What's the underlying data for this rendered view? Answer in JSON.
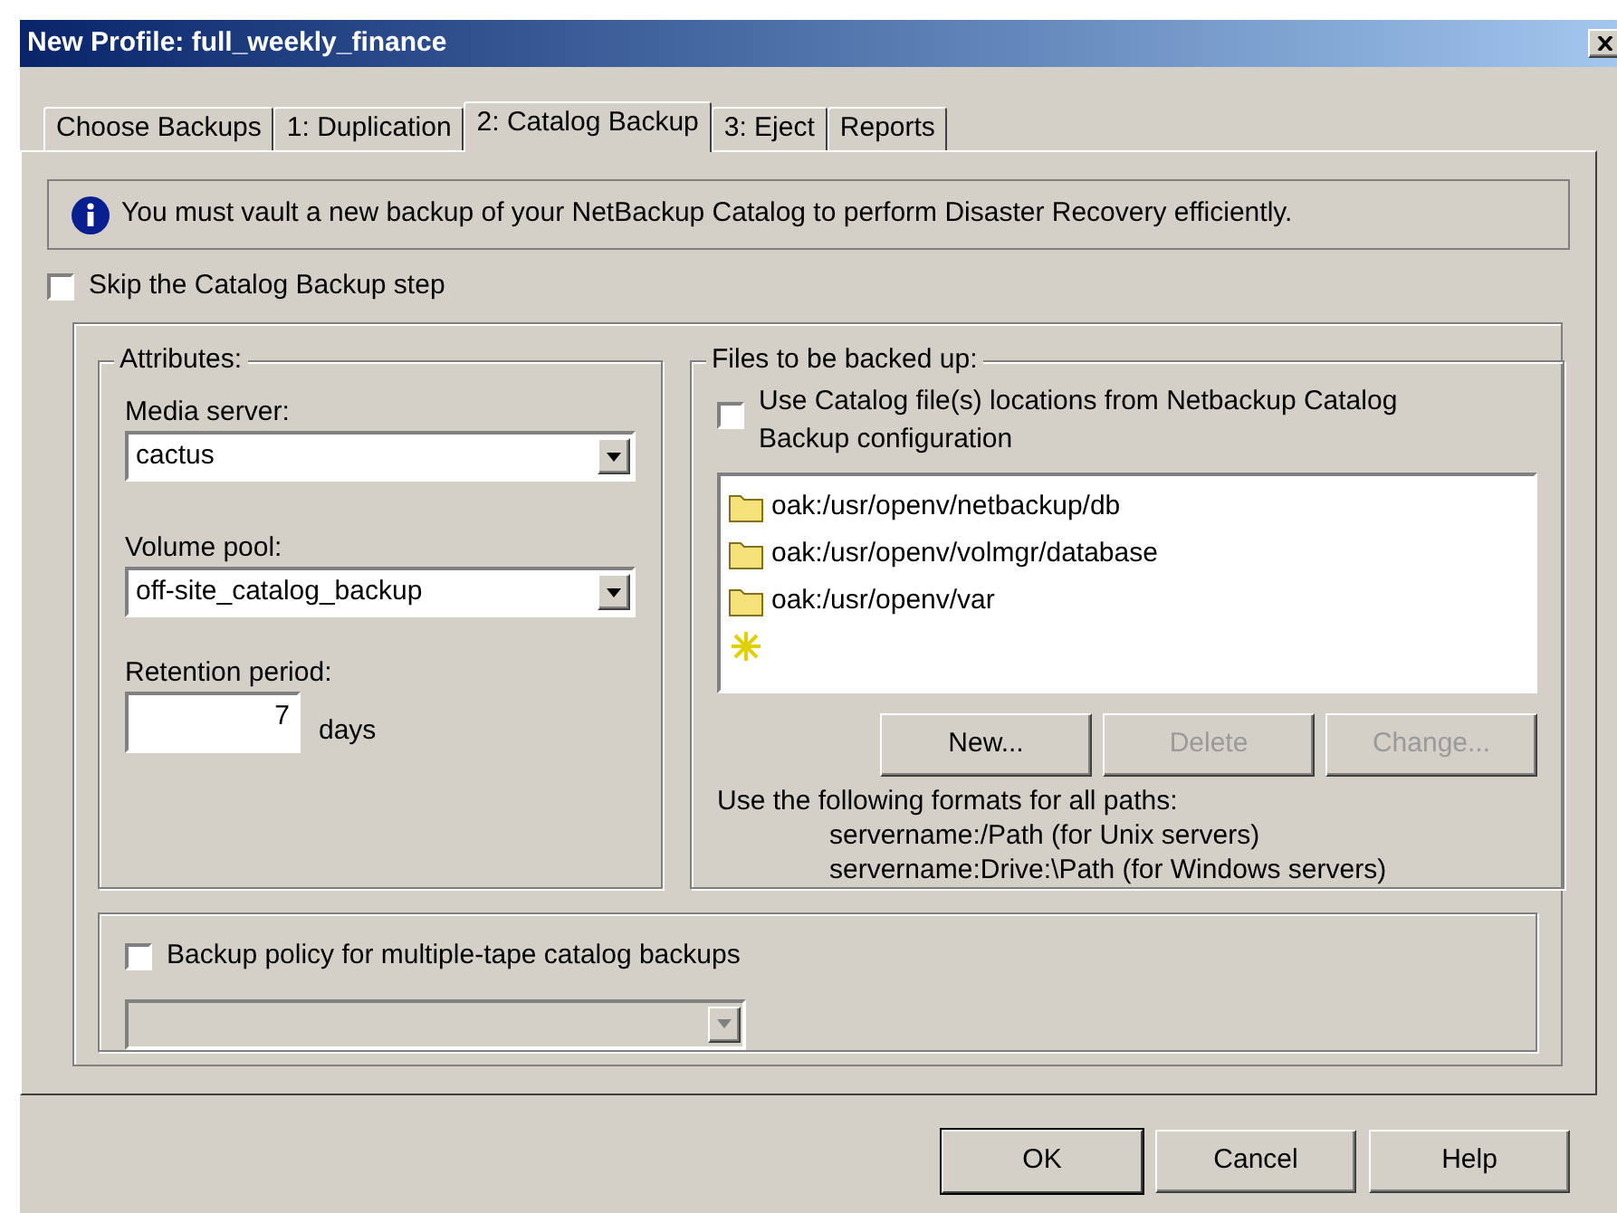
{
  "window": {
    "title": "New Profile: full_weekly_finance"
  },
  "tabs": [
    {
      "label": "Choose Backups",
      "selected": false
    },
    {
      "label": "1: Duplication",
      "selected": false
    },
    {
      "label": "2: Catalog Backup",
      "selected": true
    },
    {
      "label": "3: Eject",
      "selected": false
    },
    {
      "label": "Reports",
      "selected": false
    }
  ],
  "info": "You must vault a new backup of your NetBackup Catalog to perform Disaster Recovery efficiently.",
  "skip": {
    "label": "Skip the Catalog Backup step",
    "checked": false
  },
  "attributes": {
    "title": "Attributes:",
    "media_server": {
      "label": "Media server:",
      "value": "cactus"
    },
    "volume_pool": {
      "label": "Volume pool:",
      "value": "off-site_catalog_backup"
    },
    "retention": {
      "label": "Retention period:",
      "value": "7",
      "unit": "days"
    }
  },
  "files": {
    "title": "Files to be backed up:",
    "use_catalog": {
      "label": "Use Catalog file(s) locations from Netbackup Catalog Backup configuration",
      "checked": false
    },
    "items": [
      {
        "kind": "folder",
        "label": "oak:/usr/openv/netbackup/db"
      },
      {
        "kind": "folder",
        "label": "oak:/usr/openv/volmgr/database"
      },
      {
        "kind": "folder",
        "label": "oak:/usr/openv/var"
      },
      {
        "kind": "new"
      }
    ],
    "buttons": [
      {
        "label": "New...",
        "disabled": false
      },
      {
        "label": "Delete",
        "disabled": true
      },
      {
        "label": "Change...",
        "disabled": true
      }
    ],
    "hint": "Use the following formats for all paths:",
    "formats": [
      "servername:/Path (for Unix servers)",
      "servername:Drive:\\Path (for Windows servers)"
    ]
  },
  "policy": {
    "label": "Backup policy for multiple-tape catalog backups",
    "checked": false,
    "disabled": true
  },
  "buttons": [
    {
      "label": "OK",
      "default": true
    },
    {
      "label": "Cancel",
      "default": false
    },
    {
      "label": "Help",
      "default": false
    }
  ]
}
